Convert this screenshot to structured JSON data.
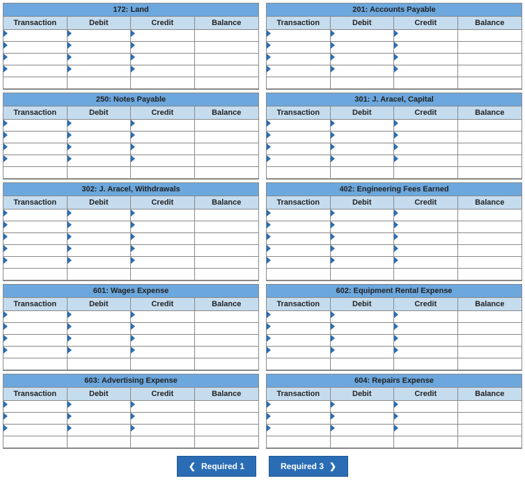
{
  "columns": [
    "Transaction",
    "Debit",
    "Credit",
    "Balance"
  ],
  "editable_row": {
    "cells": [
      "editable",
      "editable",
      "editable",
      "readonly"
    ]
  },
  "ledgers": [
    {
      "title": "172: Land",
      "editable_rows": 4,
      "blank_rows": 1
    },
    {
      "title": "201: Accounts Payable",
      "editable_rows": 4,
      "blank_rows": 1
    },
    {
      "title": "250: Notes Payable",
      "editable_rows": 4,
      "blank_rows": 1
    },
    {
      "title": "301: J. Aracel, Capital",
      "editable_rows": 4,
      "blank_rows": 1
    },
    {
      "title": "302: J. Aracel, Withdrawals",
      "editable_rows": 5,
      "blank_rows": 1
    },
    {
      "title": "402: Engineering Fees Earned",
      "editable_rows": 5,
      "blank_rows": 1
    },
    {
      "title": "601: Wages Expense",
      "editable_rows": 4,
      "blank_rows": 1
    },
    {
      "title": "602: Equipment Rental Expense",
      "editable_rows": 4,
      "blank_rows": 1
    },
    {
      "title": "603: Advertising Expense",
      "editable_rows": 3,
      "blank_rows": 1
    },
    {
      "title": "604: Repairs Expense",
      "editable_rows": 3,
      "blank_rows": 1
    }
  ],
  "nav": {
    "prev_label": "Required 1",
    "next_label": "Required 3"
  }
}
